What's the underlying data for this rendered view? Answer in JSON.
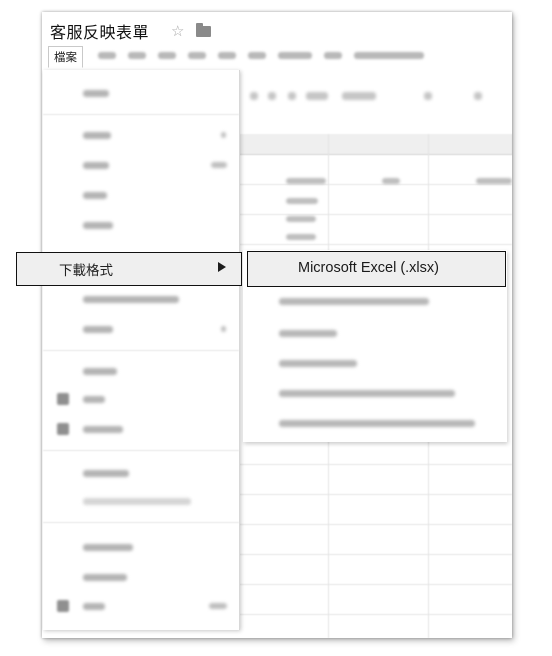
{
  "window": {
    "title": "客服反映表單",
    "icons": [
      "star-icon",
      "folder-icon"
    ]
  },
  "menubar": {
    "active_menu_label": "檔案"
  },
  "file_menu": {
    "highlighted_item": {
      "label": "下載格式",
      "submenu_arrow": "▶",
      "icon": "arrow-right-icon"
    }
  },
  "download_submenu": {
    "highlighted_item": {
      "label": "Microsoft Excel (.xlsx)"
    }
  },
  "colors": {
    "highlight_bg": "#efefef",
    "highlight_border": "#111111"
  }
}
